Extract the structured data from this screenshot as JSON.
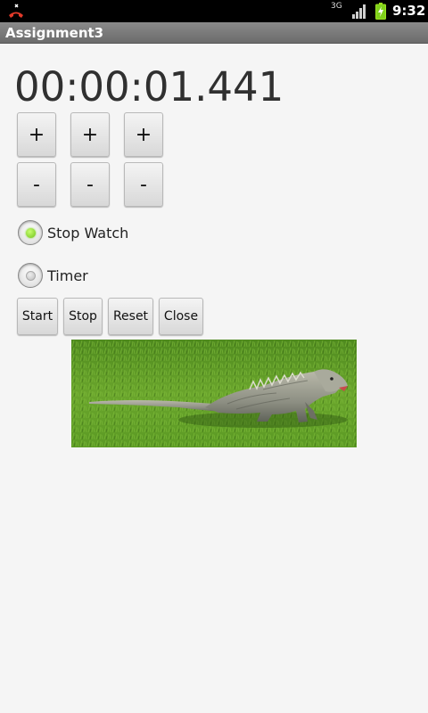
{
  "status_bar": {
    "network": "3G",
    "clock": "9:32",
    "icons": [
      "missed-call-icon",
      "signal-icon",
      "battery-charging-icon"
    ]
  },
  "app": {
    "title": "Assignment3"
  },
  "timer": {
    "display": "00:00:01.441"
  },
  "steppers": {
    "plus_label": "+",
    "minus_label": "-"
  },
  "mode": {
    "options": [
      {
        "label": "Stop Watch",
        "selected": true
      },
      {
        "label": "Timer",
        "selected": false
      }
    ]
  },
  "actions": {
    "start": "Start",
    "stop": "Stop",
    "reset": "Reset",
    "close": "Close"
  },
  "image": {
    "subject": "iguana-on-grass"
  },
  "colors": {
    "status_bar": "#000000",
    "title_bar": "#7a7a7a",
    "background": "#f5f5f5",
    "radio_selected": "#6fc21a"
  }
}
